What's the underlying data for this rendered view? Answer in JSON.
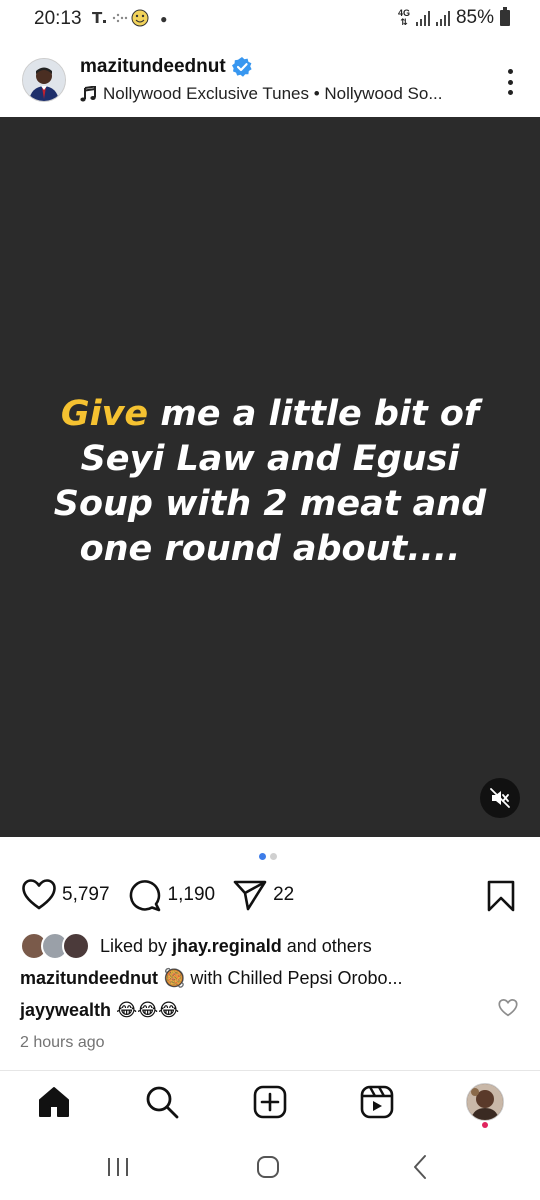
{
  "status_bar": {
    "time": "20:13",
    "network": "4G",
    "battery": "85%"
  },
  "post": {
    "username": "mazitundeednut",
    "verified": true,
    "music": "Nollywood Exclusive Tunes • Nollywood So...",
    "media_text_highlight": "Give",
    "media_text_rest": " me a little bit of Seyi Law and Egusi Soup with 2 meat and one round about....",
    "media_background": "#2b2b2b",
    "highlight_color": "#f5c231",
    "carousel": {
      "current": 1,
      "total": 2
    },
    "likes": "5,797",
    "comments": "1,190",
    "shares": "22",
    "liked_by_prefix": "Liked by ",
    "liked_by_user": "jhay.reginald",
    "liked_by_suffix": " and others",
    "caption_user": "mazitundeednut",
    "caption_text": "🥘 with Chilled Pepsi Orobo...",
    "comment_user": "jayywealth",
    "comment_text": "😂😂😂",
    "time_ago": "2 hours ago"
  },
  "icons": {
    "more": "more-vertical-icon",
    "like": "heart-icon",
    "comment": "comment-icon",
    "share": "send-icon",
    "save": "bookmark-icon",
    "mute": "speaker-muted-icon"
  },
  "bottom_nav": [
    "home",
    "search",
    "create",
    "reels",
    "profile"
  ]
}
